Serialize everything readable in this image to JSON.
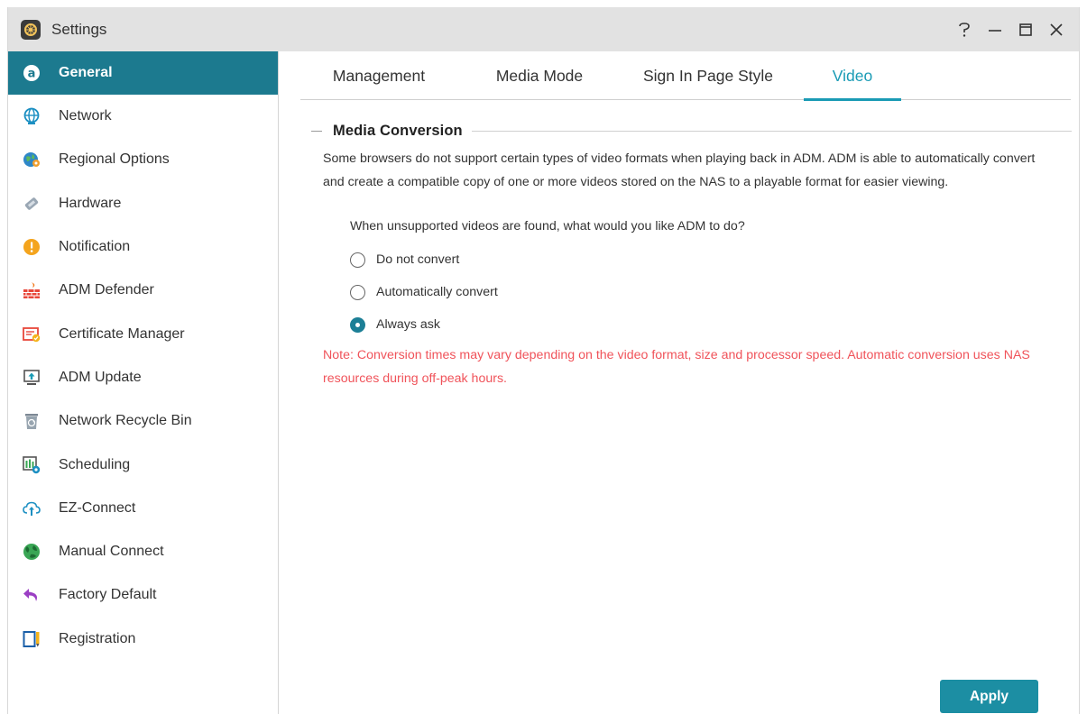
{
  "window": {
    "title": "Settings",
    "controls": {
      "help": "?",
      "minimize": "—",
      "maximize": "☐",
      "close": "✕"
    }
  },
  "sidebar": {
    "items": [
      {
        "label": "General",
        "icon": "general-icon",
        "active": true
      },
      {
        "label": "Network",
        "icon": "globe-icon"
      },
      {
        "label": "Regional Options",
        "icon": "regional-icon"
      },
      {
        "label": "Hardware",
        "icon": "hardware-icon"
      },
      {
        "label": "Notification",
        "icon": "notification-icon"
      },
      {
        "label": "ADM Defender",
        "icon": "firewall-icon"
      },
      {
        "label": "Certificate Manager",
        "icon": "certificate-icon"
      },
      {
        "label": "ADM Update",
        "icon": "update-icon"
      },
      {
        "label": "Network Recycle Bin",
        "icon": "recycle-bin-icon"
      },
      {
        "label": "Scheduling",
        "icon": "scheduling-icon"
      },
      {
        "label": "EZ-Connect",
        "icon": "cloud-upload-icon"
      },
      {
        "label": "Manual Connect",
        "icon": "manual-connect-icon"
      },
      {
        "label": "Factory Default",
        "icon": "undo-icon"
      },
      {
        "label": "Registration",
        "icon": "registration-icon"
      }
    ]
  },
  "tabs": [
    {
      "label": "Management"
    },
    {
      "label": "Media Mode"
    },
    {
      "label": "Sign In Page Style"
    },
    {
      "label": "Video",
      "active": true
    }
  ],
  "section": {
    "title": "Media Conversion",
    "description": "Some browsers do not support certain types of video formats when playing back in ADM. ADM is able to automatically convert and create a compatible copy of one or more videos stored on the NAS to a playable format for easier viewing.",
    "question": "When unsupported videos are found, what would you like ADM to do?",
    "options": [
      {
        "label": "Do not convert",
        "checked": false
      },
      {
        "label": "Automatically convert",
        "checked": false
      },
      {
        "label": "Always ask",
        "checked": true
      }
    ],
    "note": "Note: Conversion times may vary depending on the video format, size and processor speed. Automatic conversion uses NAS resources during off-peak hours."
  },
  "actions": {
    "apply_label": "Apply"
  },
  "colors": {
    "accent": "#1c7a8f",
    "tab_active": "#1a9bb5",
    "note": "#f0535a",
    "apply_button": "#1c8ea3"
  }
}
